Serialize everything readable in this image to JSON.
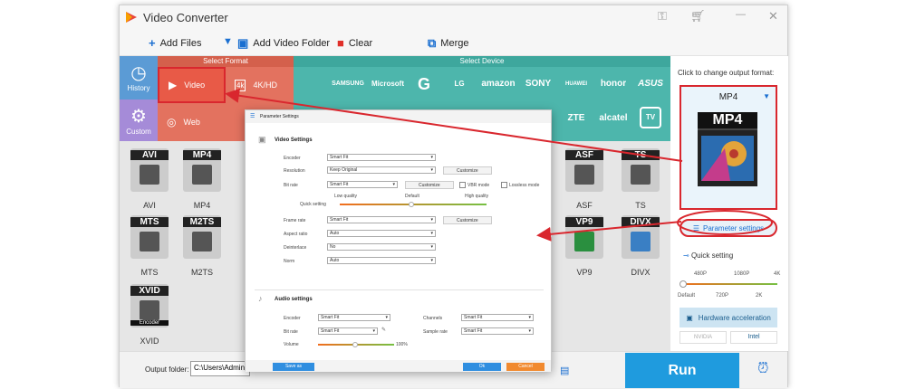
{
  "app": {
    "title": "Video Converter"
  },
  "toolbar": {
    "add_files": "Add Files",
    "add_video_folder": "Add Video Folder",
    "clear": "Clear",
    "merge": "Merge"
  },
  "categories": {
    "history": "History",
    "custom": "Custom",
    "select_format": "Select Format",
    "select_device": "Select Device",
    "video": "Video",
    "k4hd": "4K/HD",
    "web": "Web",
    "k4": "4k"
  },
  "brands": [
    "SAMSUNG",
    "Microsoft",
    "G",
    "LG",
    "amazon",
    "SONY",
    "HUAWEI",
    "honor",
    "ASUS",
    "ZTE",
    "alcatel",
    "TV"
  ],
  "formats": [
    {
      "name": "AVI",
      "badge": "AVI"
    },
    {
      "name": "MP4",
      "badge": "MP4"
    },
    {
      "name": "ASF",
      "badge": "ASF"
    },
    {
      "name": "TS",
      "badge": "TS"
    },
    {
      "name": "MTS",
      "badge": "MTS"
    },
    {
      "name": "M2TS",
      "badge": "M2TS"
    },
    {
      "name": "VP9",
      "badge": "VP9"
    },
    {
      "name": "DIVX",
      "badge": "DIVX"
    },
    {
      "name": "XVID",
      "badge": "XVID"
    }
  ],
  "encoder_tag": "Encoder",
  "right_panel": {
    "click_hint": "Click to change output format:",
    "format": "MP4",
    "format_badge": "MP4",
    "param_settings": "Parameter settings",
    "quick_setting": "Quick setting",
    "ticks_top": [
      "480P",
      "1080P",
      "4K"
    ],
    "ticks_bottom": [
      "Default",
      "720P",
      "2K"
    ],
    "hw_accel": "Hardware acceleration",
    "nvidia": "NVIDIA",
    "intel": "Intel"
  },
  "bottom": {
    "output_folder_label": "Output folder:",
    "output_folder_value": "C:\\Users\\Administra",
    "run": "Run"
  },
  "dialog": {
    "title": "Parameter Settings",
    "video_settings": "Video Settings",
    "audio_settings": "Audio settings",
    "encoder_label": "Encoder",
    "encoder_value": "Smart Fit",
    "resolution_label": "Resolution",
    "resolution_value": "Keep Original",
    "bitrate_label": "Bit rate",
    "bitrate_value": "Smart Fit",
    "customize": "Customize",
    "vbr_mode": "VBR mode",
    "lossless_mode": "Lossless mode",
    "low_quality": "Low quality",
    "default": "Default",
    "high_quality": "High quality",
    "quick_setting": "Quick setting",
    "framerate_label": "Frame rate",
    "framerate_value": "Smart Fit",
    "aspect_label": "Aspect ratio",
    "aspect_value": "Auto",
    "deinterlace_label": "Deinterlace",
    "deinterlace_value": "No",
    "norm_label": "Norm",
    "norm_value": "Auto",
    "a_encoder_label": "Encoder",
    "a_encoder_value": "Smart Fit",
    "a_bitrate_label": "Bit rate",
    "a_bitrate_value": "Smart Fit",
    "volume_label": "Volume",
    "volume_value": "100%",
    "channels_label": "Channels",
    "channels_value": "Smart Fit",
    "samplerate_label": "Sample rate",
    "samplerate_value": "Smart Fit",
    "save_as": "Save as",
    "ok": "Ok",
    "cancel": "Cancel"
  },
  "colors": {
    "accent_red": "#d9272e",
    "format_band": "#e3725f",
    "device_band": "#4db6ac",
    "history_blue": "#5b9bd5",
    "custom_purple": "#a58bd8",
    "run_blue": "#1f9bde"
  }
}
